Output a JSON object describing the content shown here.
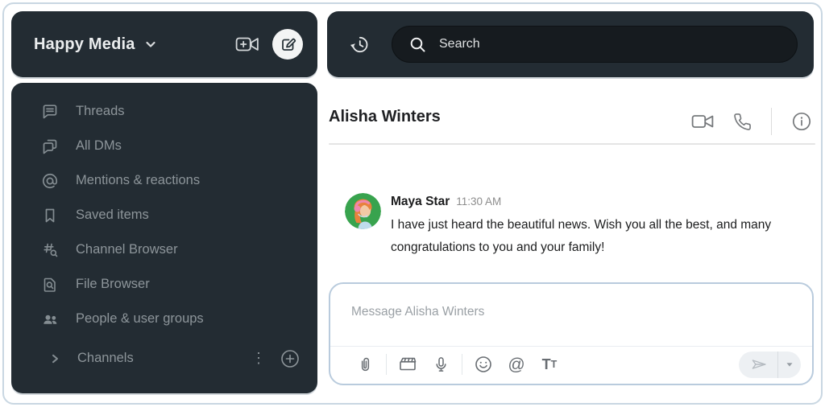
{
  "workspace": {
    "name": "Happy Media"
  },
  "sidebar": {
    "items": [
      {
        "label": "Threads"
      },
      {
        "label": "All DMs"
      },
      {
        "label": "Mentions & reactions"
      },
      {
        "label": "Saved items"
      },
      {
        "label": "Channel Browser"
      },
      {
        "label": "File Browser"
      },
      {
        "label": "People & user groups"
      }
    ],
    "channels": {
      "label": "Channels"
    }
  },
  "search": {
    "placeholder": "Search"
  },
  "chat": {
    "title": "Alisha Winters",
    "message": {
      "author": "Maya Star",
      "time": "11:30 AM",
      "text": "I have just heard the beautiful news. Wish you all the best, and many congratulations to you and your family!"
    },
    "composer": {
      "placeholder": "Message Alisha Winters"
    }
  },
  "icons": {
    "overflow_glyph": "⋮",
    "at_glyph": "@",
    "t_large": "T",
    "t_small": "T"
  },
  "colors": {
    "panel_dark": "#232c33",
    "sidebar_text": "#8d959a",
    "frame_border": "#c9d7e2",
    "composer_border": "#b9cbdd",
    "avatar_green": "#38a34e"
  }
}
